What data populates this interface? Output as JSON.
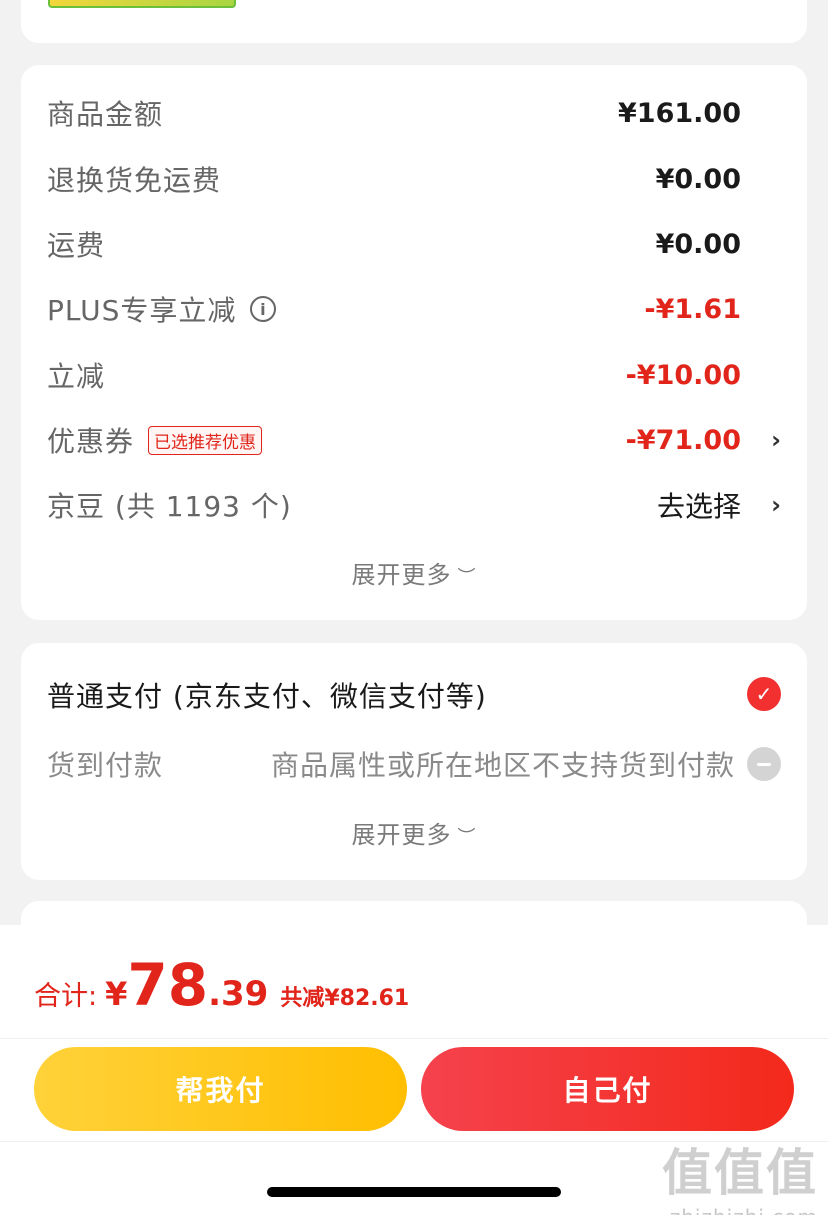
{
  "summary": {
    "rows": [
      {
        "label": "商品金额",
        "value": "¥161.00"
      },
      {
        "label": "退换货免运费",
        "value": "¥0.00"
      },
      {
        "label": "运费",
        "value": "¥0.00"
      },
      {
        "label": "PLUS专享立减",
        "value": "-¥1.61"
      },
      {
        "label": "立减",
        "value": "-¥10.00"
      },
      {
        "label": "优惠券",
        "tag": "已选推荐优惠",
        "value": "-¥71.00"
      },
      {
        "label": "京豆 (共 1193 个)",
        "value": "去选择"
      }
    ],
    "expand_label": "展开更多"
  },
  "payment": {
    "main_option": "普通支付 (京东支付、微信支付等)",
    "cod_label": "货到付款",
    "cod_note": "商品属性或所在地区不支持货到付款",
    "expand_label": "展开更多"
  },
  "footer": {
    "total_label": "合计:",
    "currency": "¥",
    "total_int": "78",
    "total_dec": ".39",
    "saved": "共减¥82.61",
    "help_pay_label": "帮我付",
    "self_pay_label": "自己付"
  },
  "watermark": {
    "big": "值值值",
    "small": "zhizhizhi.com"
  },
  "colors": {
    "accent_red": "#e1251b",
    "help_yellow": "#ffbe00",
    "pay_red": "#f3291b"
  }
}
